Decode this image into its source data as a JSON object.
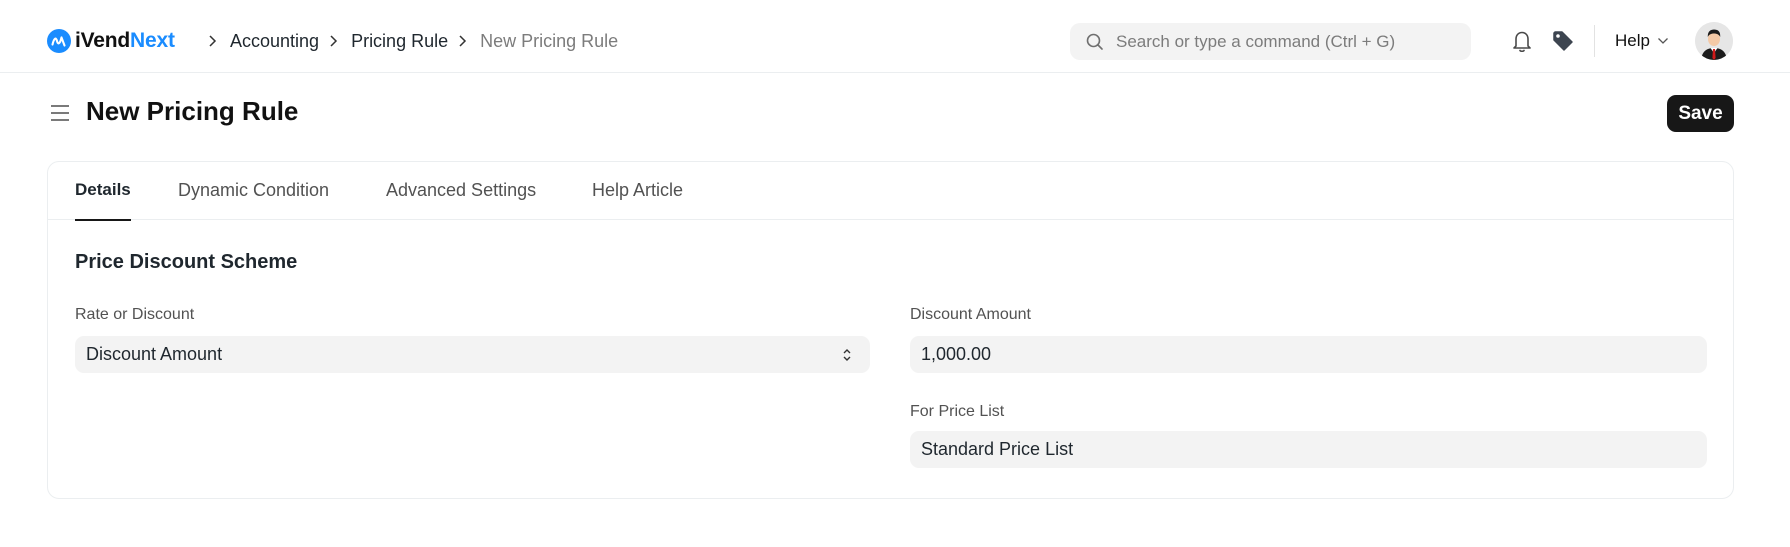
{
  "navbar": {
    "logo": {
      "text_main": "iVend",
      "text_accent": "Next"
    },
    "breadcrumbs": [
      {
        "label": "Accounting"
      },
      {
        "label": "Pricing Rule"
      },
      {
        "label": "New Pricing Rule"
      }
    ],
    "search": {
      "placeholder": "Search or type a command (Ctrl + G)",
      "value": ""
    },
    "icons": [
      "bell-icon",
      "tag-icon"
    ],
    "help_label": "Help"
  },
  "page": {
    "title": "New Pricing Rule",
    "save_label": "Save"
  },
  "tabs": [
    {
      "label": "Details",
      "active": true
    },
    {
      "label": "Dynamic Condition",
      "active": false
    },
    {
      "label": "Advanced Settings",
      "active": false
    },
    {
      "label": "Help Article",
      "active": false
    }
  ],
  "section": {
    "title": "Price Discount Scheme",
    "fields": {
      "rate_or_discount": {
        "label": "Rate or Discount",
        "value": "Discount Amount"
      },
      "discount_amount": {
        "label": "Discount Amount",
        "value": "1,000.00"
      },
      "for_price_list": {
        "label": "For Price List",
        "value": "Standard Price List"
      }
    }
  },
  "colors": {
    "accent": "#1a8cff",
    "primary_button": "#171717",
    "control_bg": "#f3f3f3",
    "border": "#ebeef0",
    "tag_icon": "#3d4550"
  }
}
